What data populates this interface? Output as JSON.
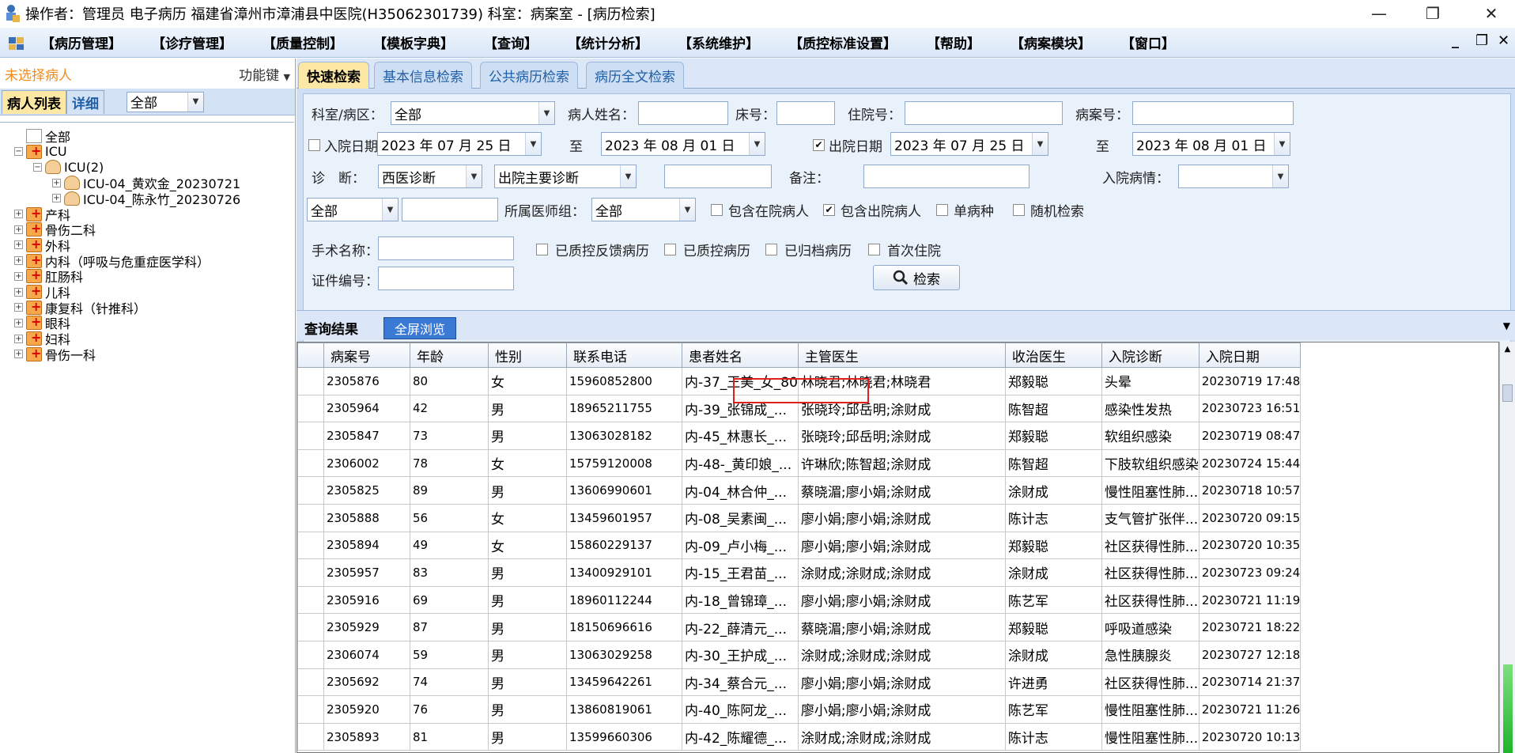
{
  "titlebar": {
    "title": "操作者：管理员 电子病历  福建省漳州市漳浦县中医院(H35062301739)  科室：病案室 - [病历检索]",
    "minimize": "—",
    "restore": "❐",
    "close": "✕"
  },
  "menu": {
    "items": [
      "【病历管理】",
      "【诊疗管理】",
      "【质量控制】",
      "【模板字典】",
      "【查询】",
      "【统计分析】",
      "【系统维护】",
      "【质控标准设置】",
      "【帮助】",
      "【病案模块】",
      "【窗口】"
    ],
    "mdi_min": "_",
    "mdi_restore": "❐",
    "mdi_close": "✕"
  },
  "left": {
    "no_patient": "未选择病人",
    "function_key": "功能键",
    "tab_list": "病人列表",
    "tab_detail": "详细",
    "filter_value": "全部",
    "tree": [
      {
        "label": "全部",
        "level": 0,
        "icon": "doc",
        "expander": ""
      },
      {
        "label": "ICU",
        "level": 0,
        "icon": "hosp",
        "expander": "−"
      },
      {
        "label": "ICU(2)",
        "level": 1,
        "icon": "group",
        "expander": "−"
      },
      {
        "label": "ICU-04_黄欢金_20230721",
        "level": 2,
        "icon": "person",
        "expander": "+"
      },
      {
        "label": "ICU-04_陈永竹_20230726",
        "level": 2,
        "icon": "person",
        "expander": "+"
      },
      {
        "label": "产科",
        "level": 0,
        "icon": "hosp",
        "expander": "+"
      },
      {
        "label": "骨伤二科",
        "level": 0,
        "icon": "hosp",
        "expander": "+"
      },
      {
        "label": "外科",
        "level": 0,
        "icon": "hosp",
        "expander": "+"
      },
      {
        "label": "内科（呼吸与危重症医学科）",
        "level": 0,
        "icon": "hosp",
        "expander": "+"
      },
      {
        "label": "肛肠科",
        "level": 0,
        "icon": "hosp",
        "expander": "+"
      },
      {
        "label": "儿科",
        "level": 0,
        "icon": "hosp",
        "expander": "+"
      },
      {
        "label": "康复科（针推科）",
        "level": 0,
        "icon": "hosp",
        "expander": "+"
      },
      {
        "label": "眼科",
        "level": 0,
        "icon": "hosp",
        "expander": "+"
      },
      {
        "label": "妇科",
        "level": 0,
        "icon": "hosp",
        "expander": "+"
      },
      {
        "label": "骨伤一科",
        "level": 0,
        "icon": "hosp",
        "expander": "+"
      }
    ]
  },
  "tabs": [
    "快速检索",
    "基本信息检索",
    "公共病历检索",
    "病历全文检索"
  ],
  "form": {
    "dept_label": "科室/病区：",
    "dept_value": "全部",
    "name_label": "病人姓名：",
    "bed_label": "床号：",
    "inpatient_no_label": "住院号：",
    "case_no_label": "病案号：",
    "admit_date_label": "入院日期",
    "admit_from": "2023 年 07 月 25 日",
    "admit_to": "2023 年 08 月 01 日",
    "to_label": "至",
    "discharge_date_label": "出院日期",
    "discharge_from": "2023 年 07 月 25 日",
    "discharge_to": "2023 年 08 月 01 日",
    "diag_label": "诊　断：",
    "diag_type": "西医诊断",
    "diag_kind": "出院主要诊断",
    "remark_label": "备注：",
    "admit_cond_label": "入院病情：",
    "scope_value": "全部",
    "doctor_group_label": "所属医师组：",
    "doctor_group_value": "全部",
    "cb_in_hospital": "包含在院病人",
    "cb_discharged": "包含出院病人",
    "cb_single": "单病种",
    "cb_random": "随机检索",
    "surgery_label": "手术名称：",
    "cb_feedback": "已质控反馈病历",
    "cb_qc": "已质控病历",
    "cb_archived": "已归档病历",
    "cb_first": "首次住院",
    "id_label": "证件编号：",
    "search_btn": "检索"
  },
  "results": {
    "tab": "查询结果",
    "fullscreen": "全屏浏览",
    "columns": [
      "病案号",
      "年龄",
      "性别",
      "联系电话",
      "患者姓名",
      "主管医生",
      "收治医生",
      "入院诊断",
      "入院日期"
    ],
    "rows": [
      [
        "2305876",
        "80",
        "女",
        "15960852800",
        "内-37_王美_女_80",
        "林晓君;林晓君;林晓君",
        "郑毅聪",
        "头晕",
        "20230719 17:48"
      ],
      [
        "2305964",
        "42",
        "男",
        "18965211755",
        "内-39_张锦成_...",
        "张晓玲;邱岳明;涂财成",
        "陈智超",
        "感染性发热",
        "20230723 16:51"
      ],
      [
        "2305847",
        "73",
        "男",
        "13063028182",
        "内-45_林惠长_...",
        "张晓玲;邱岳明;涂财成",
        "郑毅聪",
        "软组织感染",
        "20230719 08:47"
      ],
      [
        "2306002",
        "78",
        "女",
        "15759120008",
        "内-48-_黄印娘_...",
        "许琳欣;陈智超;涂财成",
        "陈智超",
        "下肢软组织感染",
        "20230724 15:44"
      ],
      [
        "2305825",
        "89",
        "男",
        "13606990601",
        "内-04_林合仲_...",
        "蔡晓湄;廖小娟;涂财成",
        "涂财成",
        "慢性阻塞性肺...",
        "20230718 10:57"
      ],
      [
        "2305888",
        "56",
        "女",
        "13459601957",
        "内-08_吴素闽_...",
        "廖小娟;廖小娟;涂财成",
        "陈计志",
        "支气管扩张伴...",
        "20230720 09:15"
      ],
      [
        "2305894",
        "49",
        "女",
        "15860229137",
        "内-09_卢小梅_...",
        "廖小娟;廖小娟;涂财成",
        "郑毅聪",
        "社区获得性肺...",
        "20230720 10:35"
      ],
      [
        "2305957",
        "83",
        "男",
        "13400929101",
        "内-15_王君苗_...",
        "涂财成;涂财成;涂财成",
        "涂财成",
        "社区获得性肺...",
        "20230723 09:24"
      ],
      [
        "2305916",
        "69",
        "男",
        "18960112244",
        "内-18_曾锦璋_...",
        "廖小娟;廖小娟;涂财成",
        "陈艺军",
        "社区获得性肺...",
        "20230721 11:19"
      ],
      [
        "2305929",
        "87",
        "男",
        "18150696616",
        "内-22_薛清元_...",
        "蔡晓湄;廖小娟;涂财成",
        "郑毅聪",
        "呼吸道感染",
        "20230721 18:22"
      ],
      [
        "2306074",
        "59",
        "男",
        "13063029258",
        "内-30_王护成_...",
        "涂财成;涂财成;涂财成",
        "涂财成",
        "急性胰腺炎",
        "20230727 12:18"
      ],
      [
        "2305692",
        "74",
        "男",
        "13459642261",
        "内-34_蔡合元_...",
        "廖小娟;廖小娟;涂财成",
        "许进勇",
        "社区获得性肺...",
        "20230714 21:37"
      ],
      [
        "2305920",
        "76",
        "男",
        "13860819061",
        "内-40_陈阿龙_...",
        "廖小娟;廖小娟;涂财成",
        "陈艺军",
        "慢性阻塞性肺...",
        "20230721 11:26"
      ],
      [
        "2305893",
        "81",
        "男",
        "13599660306",
        "内-42_陈耀德_...",
        "涂财成;涂财成;涂财成",
        "陈计志",
        "慢性阻塞性肺...",
        "20230720 10:13"
      ]
    ]
  },
  "colors": {
    "accent": "#3b7ad4",
    "active_tab": "#fde7a5",
    "highlight": "#e0201f",
    "nosel": "#f08c1e"
  }
}
